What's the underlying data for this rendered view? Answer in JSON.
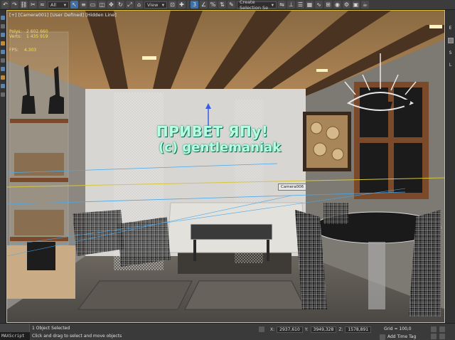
{
  "toolbar": {
    "filter_dropdown": "All",
    "view_dropdown": "View",
    "selection_set": "Create Selection Se",
    "icons": [
      "undo-icon",
      "redo-icon",
      "link-icon",
      "unlink-icon",
      "bind-icon",
      "select-icon",
      "select-by-name-icon",
      "rect-region-icon",
      "window-crossing-icon",
      "move-icon",
      "rotate-icon",
      "scale-icon",
      "place-icon",
      "pivot-icon",
      "snap-icon",
      "angle-snap-icon",
      "percent-snap-icon",
      "spinner-snap-icon",
      "edit-named-sets-icon",
      "mirror-icon",
      "align-icon",
      "layer-icon",
      "graphite-icon",
      "curve-editor-icon",
      "schematic-icon",
      "material-editor-icon",
      "render-setup-icon",
      "render-frame-icon",
      "render-icon"
    ]
  },
  "viewport": {
    "label_parts": [
      "[+]",
      "[Camera001]",
      "[User Defined]",
      "[Hidden Line]"
    ],
    "stats": [
      {
        "label": "Polys:",
        "value": "2 602 660"
      },
      {
        "label": "Verts:",
        "value": "1 435 919"
      }
    ],
    "fps_label": "FPS:",
    "fps_value": "4.303",
    "overlay_line1": "ПРИВЕТ ЯПу!",
    "overlay_line2": "(c) gentlemaniak",
    "camera_tag": "Camera006"
  },
  "right_panel": {
    "labels": [
      "E",
      "S",
      "L"
    ]
  },
  "status": {
    "maxscript_label": "MAXScript Mi",
    "selected": "1 Object Selected",
    "prompt": "Click and drag to select and move objects",
    "x_label": "X:",
    "x_value": "2937,610",
    "y_label": "Y:",
    "y_value": "3949,328",
    "z_label": "Z:",
    "z_value": "1578,891",
    "grid": "Grid = 100,0",
    "add_time_tag": "Add Time Tag"
  }
}
